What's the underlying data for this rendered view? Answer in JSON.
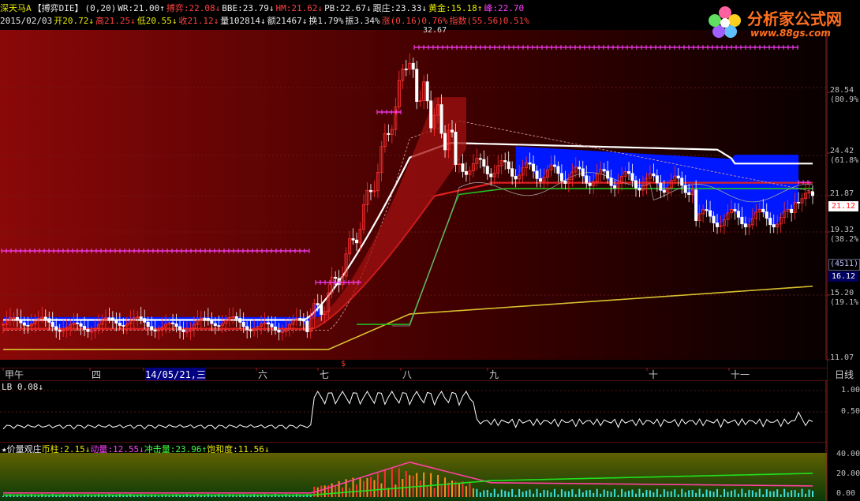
{
  "header": {
    "row1": [
      {
        "text": "深天马A",
        "cls": "y"
      },
      {
        "text": "【搏弈DIE】",
        "cls": "w"
      },
      {
        "text": "(0,20)",
        "cls": "w"
      },
      {
        "text": "WR:21.00↑",
        "cls": "w"
      },
      {
        "text": "搏弈:22.08↓",
        "cls": "r"
      },
      {
        "text": "BBE:23.79↓",
        "cls": "w"
      },
      {
        "text": "HM:21.62↓",
        "cls": "r"
      },
      {
        "text": "PB:22.67↓",
        "cls": "w"
      },
      {
        "text": "跟庄:23.33↓",
        "cls": "w"
      },
      {
        "text": "黄金:15.18↑",
        "cls": "y"
      },
      {
        "text": "峰:22.70",
        "cls": "m"
      }
    ],
    "row2": [
      {
        "text": "2015/02/03",
        "cls": "w"
      },
      {
        "text": "开20.72↓",
        "cls": "y"
      },
      {
        "text": "高21.25↓",
        "cls": "r"
      },
      {
        "text": "低20.55↓",
        "cls": "y"
      },
      {
        "text": "收21.12↓",
        "cls": "r"
      },
      {
        "text": "量102814↓",
        "cls": "w"
      },
      {
        "text": "额21467↓",
        "cls": "w"
      },
      {
        "text": "换1.79%",
        "cls": "w"
      },
      {
        "text": "振3.34%",
        "cls": "w"
      },
      {
        "text": "涨(0.16)0.76%",
        "cls": "r"
      },
      {
        "text": "指数(55.56)0.51%",
        "cls": "r"
      }
    ]
  },
  "logo": {
    "title": "分析家公式网",
    "url": "www.88gs.com"
  },
  "main_chart": {
    "peak_label": "32.67",
    "right_axis": [
      {
        "value": "28.54",
        "pct": "(80.9%)"
      },
      {
        "value": "24.42",
        "pct": "(61.8%)"
      },
      {
        "value": "21.87",
        "pct": ""
      },
      {
        "value": "19.32",
        "pct": "(38.2%)"
      },
      {
        "value": "15.20",
        "pct": "(19.1%)"
      },
      {
        "value": "11.07",
        "pct": ""
      }
    ],
    "current_price": "21.12",
    "volume_box": "(4511)",
    "price_box2": "16.12",
    "marker": "$"
  },
  "x_axis": {
    "labels": [
      "甲午",
      "四",
      "14/05/21,三",
      "六",
      "七",
      "八",
      "九",
      "十",
      "十一"
    ],
    "period": "日线"
  },
  "sub1": {
    "title": "LB 0.08↓",
    "axis": [
      "1.00",
      "0.50"
    ]
  },
  "sub2": {
    "items": [
      {
        "text": "★价量观庄",
        "cls": "w"
      },
      {
        "text": "币柱:2.15↓",
        "cls": "y"
      },
      {
        "text": "动量:12.55↓",
        "cls": "m"
      },
      {
        "text": "冲击量:23.96↑",
        "cls": "g"
      },
      {
        "text": "饱和度:11.56↓",
        "cls": "y"
      }
    ],
    "axis": [
      "40.00",
      "20.00",
      "0.00"
    ]
  },
  "colors": {
    "bg": "#000000",
    "up": "#ff3030",
    "down": "#ffffff",
    "cloud": "#0018ff",
    "ma_yellow": "#d8c030",
    "ma_green": "#20c020",
    "ma_red": "#e02020"
  }
}
